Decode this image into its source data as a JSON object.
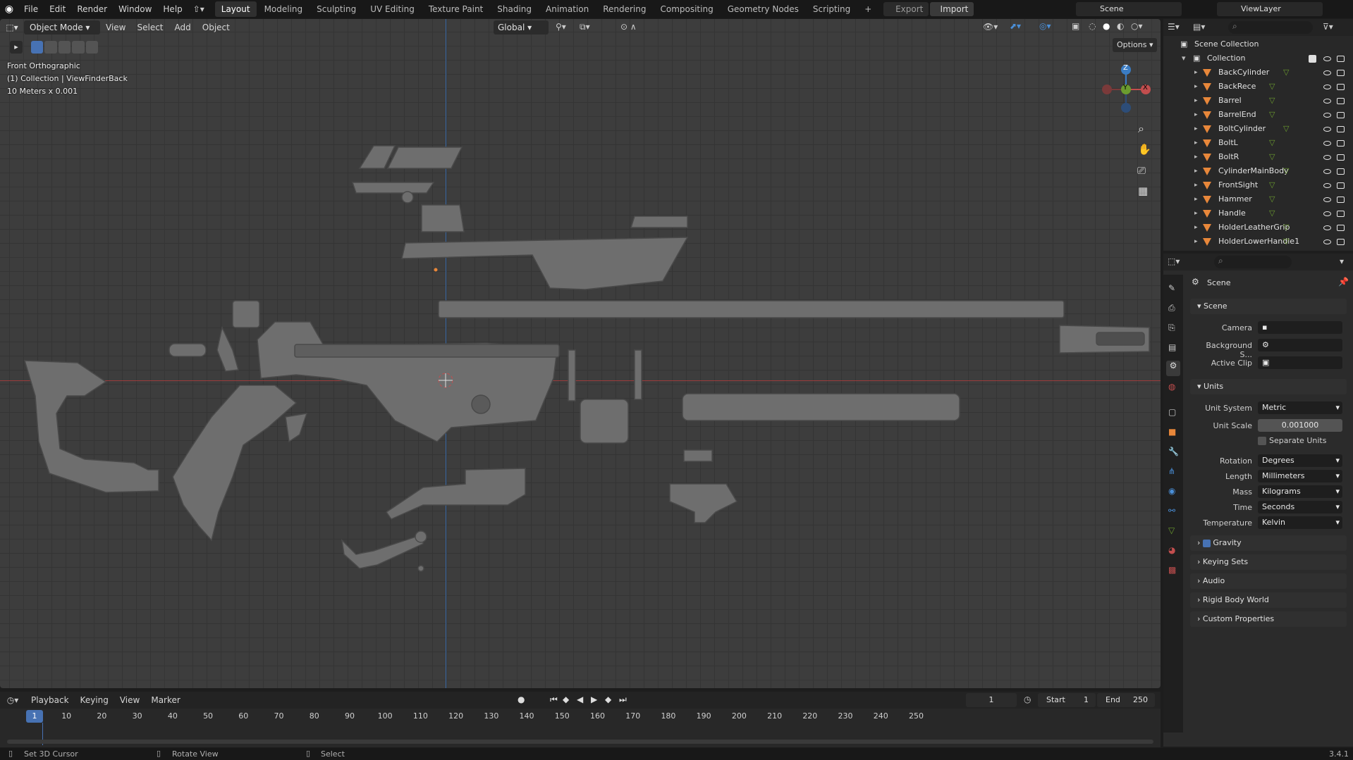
{
  "app": {
    "menus": [
      "File",
      "Edit",
      "Render",
      "Window",
      "Help"
    ],
    "workspaces": [
      "Layout",
      "Modeling",
      "Sculpting",
      "UV Editing",
      "Texture Paint",
      "Shading",
      "Animation",
      "Rendering",
      "Compositing",
      "Geometry Nodes",
      "Scripting"
    ],
    "active_workspace": "Layout",
    "export_label": "Export",
    "import_label": "Import",
    "scene_name": "Scene",
    "view_layer": "ViewLayer",
    "version": "3.4.1"
  },
  "viewport_header": {
    "mode": "Object Mode",
    "menus": [
      "View",
      "Select",
      "Add",
      "Object"
    ],
    "orientation": "Global",
    "options_label": "Options"
  },
  "viewport_overlay": {
    "view_name": "Front Orthographic",
    "collection_info": "(1) Collection | ViewFinderBack",
    "scale_info": "10 Meters x 0.001"
  },
  "gizmo": {
    "z": "Z",
    "y": "Y",
    "x": "X"
  },
  "outliner": {
    "root": "Scene Collection",
    "collection": "Collection",
    "items": [
      "BackCylinder",
      "BackRece",
      "Barrel",
      "BarrelEnd",
      "BoltCylinder",
      "BoltL",
      "BoltR",
      "CylinderMainBody",
      "FrontSight",
      "Hammer",
      "Handle",
      "HolderLeatherGrip",
      "HolderLowerHandle1"
    ]
  },
  "properties": {
    "context_title": "Scene",
    "scene_section": "Scene",
    "camera_label": "Camera",
    "background_label": "Background S...",
    "active_clip_label": "Active Clip",
    "units_section": "Units",
    "unit_system_label": "Unit System",
    "unit_system": "Metric",
    "unit_scale_label": "Unit Scale",
    "unit_scale": "0.001000",
    "separate_units": "Separate Units",
    "rotation_label": "Rotation",
    "rotation": "Degrees",
    "length_label": "Length",
    "length": "Millimeters",
    "mass_label": "Mass",
    "mass": "Kilograms",
    "time_label": "Time",
    "time": "Seconds",
    "temperature_label": "Temperature",
    "temperature": "Kelvin",
    "collapsed_sections": [
      "Gravity",
      "Keying Sets",
      "Audio",
      "Rigid Body World",
      "Custom Properties"
    ]
  },
  "timeline": {
    "menus": [
      "Playback",
      "Keying",
      "View",
      "Marker"
    ],
    "current_frame": "1",
    "start_label": "Start",
    "start": "1",
    "end_label": "End",
    "end": "250",
    "ticks": [
      "10",
      "20",
      "30",
      "40",
      "50",
      "60",
      "70",
      "80",
      "90",
      "100",
      "110",
      "120",
      "130",
      "140",
      "150",
      "160",
      "170",
      "180",
      "190",
      "200",
      "210",
      "220",
      "230",
      "240",
      "250"
    ]
  },
  "statusbar": {
    "hint1": "Set 3D Cursor",
    "hint2": "Rotate View",
    "hint3": "Select"
  },
  "colors": {
    "accent": "#4772b3",
    "mesh_orange": "#e8873a",
    "x_axis": "#c24e4e",
    "y_axis": "#6b9c2f",
    "z_axis": "#3a7cc4"
  }
}
